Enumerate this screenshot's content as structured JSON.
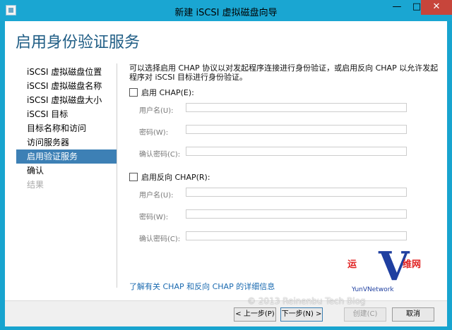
{
  "window": {
    "title": "新建 iSCSI 虚拟磁盘向导"
  },
  "page": {
    "title": "启用身份验证服务"
  },
  "nav": {
    "items": [
      {
        "label": "iSCSI 虚拟磁盘位置",
        "state": "normal"
      },
      {
        "label": "iSCSI 虚拟磁盘名称",
        "state": "normal"
      },
      {
        "label": "iSCSI 虚拟磁盘大小",
        "state": "normal"
      },
      {
        "label": "iSCSI 目标",
        "state": "normal"
      },
      {
        "label": "目标名称和访问",
        "state": "normal"
      },
      {
        "label": "访问服务器",
        "state": "normal"
      },
      {
        "label": "启用验证服务",
        "state": "active"
      },
      {
        "label": "确认",
        "state": "normal"
      },
      {
        "label": "结果",
        "state": "disabled"
      }
    ]
  },
  "main": {
    "description": "可以选择启用 CHAP 协议以对发起程序连接进行身份验证，或启用反向 CHAP 以允许发起程序对 iSCSI 目标进行身份验证。",
    "chap": {
      "checkbox_label": "启用 CHAP(E):",
      "checked": false,
      "username_label": "用户名(U):",
      "password_label": "密码(W):",
      "confirm_label": "确认密码(C):",
      "username_value": "",
      "password_value": "",
      "confirm_value": ""
    },
    "reverse_chap": {
      "checkbox_label": "启用反向 CHAP(R):",
      "checked": false,
      "username_label": "用户名(U):",
      "password_label": "密码(W):",
      "confirm_label": "确认密码(C):",
      "username_value": "",
      "password_value": "",
      "confirm_value": ""
    },
    "link": "了解有关 CHAP 和反向 CHAP 的详细信息"
  },
  "footer": {
    "prev": "< 上一步(P)",
    "next": "下一步(N) >",
    "create": "创建(C)",
    "cancel": "取消"
  },
  "watermark": {
    "copyright": "© 2013 Reinenbu Tech Blog",
    "logo_left": "运",
    "logo_mid": "V",
    "logo_right": "维网",
    "logo_tag": "YunVNetwork"
  },
  "colors": {
    "titlebar": "#1aa6d2",
    "nav_active": "#3d80b5",
    "page_title": "#1f5d85",
    "close_button": "#c7453b",
    "link": "#1a6ab0"
  }
}
